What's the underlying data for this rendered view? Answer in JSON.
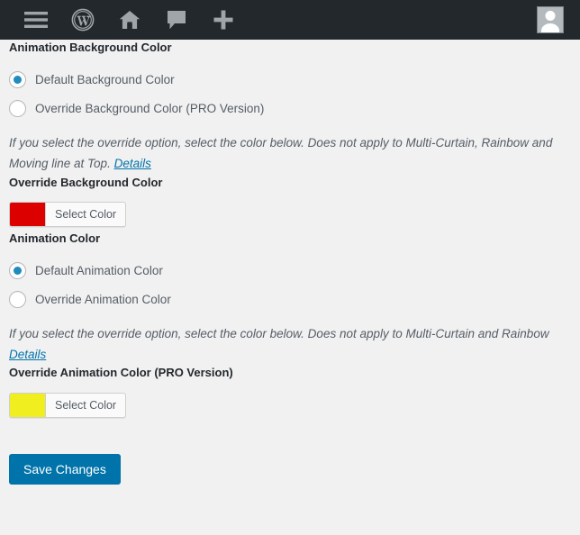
{
  "adminbar": {
    "icons": [
      {
        "name": "menu-icon",
        "label": "Menu"
      },
      {
        "name": "wordpress-logo-icon",
        "label": "WordPress"
      },
      {
        "name": "site-home-icon",
        "label": "Home"
      },
      {
        "name": "comments-icon",
        "label": "Comments"
      },
      {
        "name": "new-content-icon",
        "label": "New"
      }
    ],
    "avatar_label": "Account"
  },
  "colors": {
    "admin_bar_bg": "#23282d",
    "page_bg": "#f1f1f1",
    "accent": "#0073aa",
    "radio_dot": "#1e8cbe",
    "override_background_swatch": "#dd0000",
    "override_animation_swatch": "#f0ee1e"
  },
  "sections": {
    "animation_background_color": {
      "heading": "Animation Background Color",
      "options": [
        {
          "label": "Default Background Color",
          "checked": true
        },
        {
          "label": "Override Background Color (PRO Version)",
          "checked": false
        }
      ],
      "description": "If you select the override option, select the color below. Does not apply to Multi-Curtain, Rainbow and Moving line at Top.",
      "details_link": "Details"
    },
    "override_background_color": {
      "heading": "Override Background Color",
      "select_color_label": "Select Color",
      "swatch": "#dd0000"
    },
    "animation_color": {
      "heading": "Animation Color",
      "options": [
        {
          "label": "Default Animation Color",
          "checked": true
        },
        {
          "label": "Override Animation Color",
          "checked": false
        }
      ],
      "description": "If you select the override option, select the color below. Does not apply to Multi-Curtain and Rainbow",
      "details_link": "Details"
    },
    "override_animation_color": {
      "heading": "Override Animation Color (PRO Version)",
      "select_color_label": "Select Color",
      "swatch": "#f0ee1e"
    }
  },
  "footer": {
    "save_label": "Save Changes"
  }
}
